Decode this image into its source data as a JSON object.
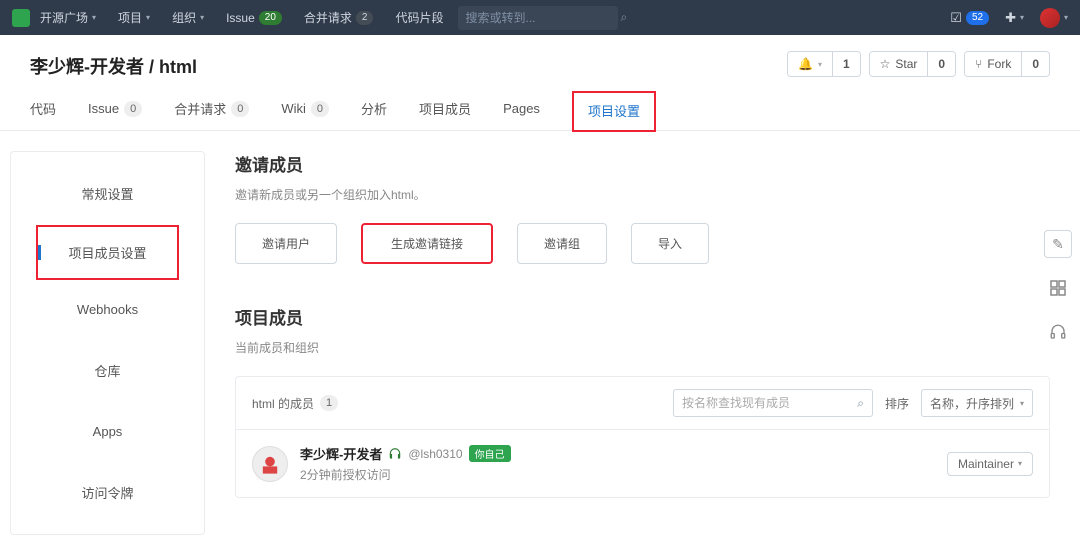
{
  "top_nav": {
    "items": [
      {
        "label": "开源广场",
        "caret": true
      },
      {
        "label": "项目",
        "caret": true
      },
      {
        "label": "组织",
        "caret": true
      },
      {
        "label": "Issue",
        "badge": "20"
      },
      {
        "label": "合并请求",
        "badge_gray": "2"
      },
      {
        "label": "代码片段"
      }
    ],
    "search_placeholder": "搜索或转到...",
    "right": {
      "todo_count": "52",
      "plus": "+"
    }
  },
  "repo": {
    "title": "李少辉-开发者 / html",
    "actions": {
      "notify": {
        "icon": "bell",
        "count": "1"
      },
      "star": {
        "label": "Star",
        "count": "0"
      },
      "fork": {
        "label": "Fork",
        "count": "0"
      }
    }
  },
  "tabs": [
    {
      "label": "代码"
    },
    {
      "label": "Issue",
      "count": "0"
    },
    {
      "label": "合并请求",
      "count": "0"
    },
    {
      "label": "Wiki",
      "count": "0"
    },
    {
      "label": "分析"
    },
    {
      "label": "项目成员"
    },
    {
      "label": "Pages"
    },
    {
      "label": "项目设置",
      "active": true,
      "highlight": true
    }
  ],
  "sidebar": {
    "items": [
      {
        "label": "常规设置"
      },
      {
        "label": "项目成员设置",
        "active": true,
        "highlight": true
      },
      {
        "label": "Webhooks"
      },
      {
        "label": "仓库"
      },
      {
        "label": "Apps"
      },
      {
        "label": "访问令牌"
      }
    ]
  },
  "invite": {
    "title": "邀请成员",
    "subtitle": "邀请新成员或另一个组织加入html。",
    "buttons": [
      {
        "label": "邀请用户"
      },
      {
        "label": "生成邀请链接",
        "highlight": true
      },
      {
        "label": "邀请组"
      },
      {
        "label": "导入"
      }
    ]
  },
  "members": {
    "title": "项目成员",
    "sub": "当前成员和组织",
    "panel_label": "html 的成员",
    "panel_count": "1",
    "filter_placeholder": "按名称查找现有成员",
    "sort_label": "排序",
    "sort_value": "名称，升序排列",
    "rows": [
      {
        "name": "李少辉-开发者",
        "handle": "@lsh0310",
        "self_tag": "你自己",
        "meta": "2分钟前授权访问",
        "role": "Maintainer"
      }
    ]
  },
  "float_icons": [
    "edit",
    "grid",
    "support"
  ]
}
